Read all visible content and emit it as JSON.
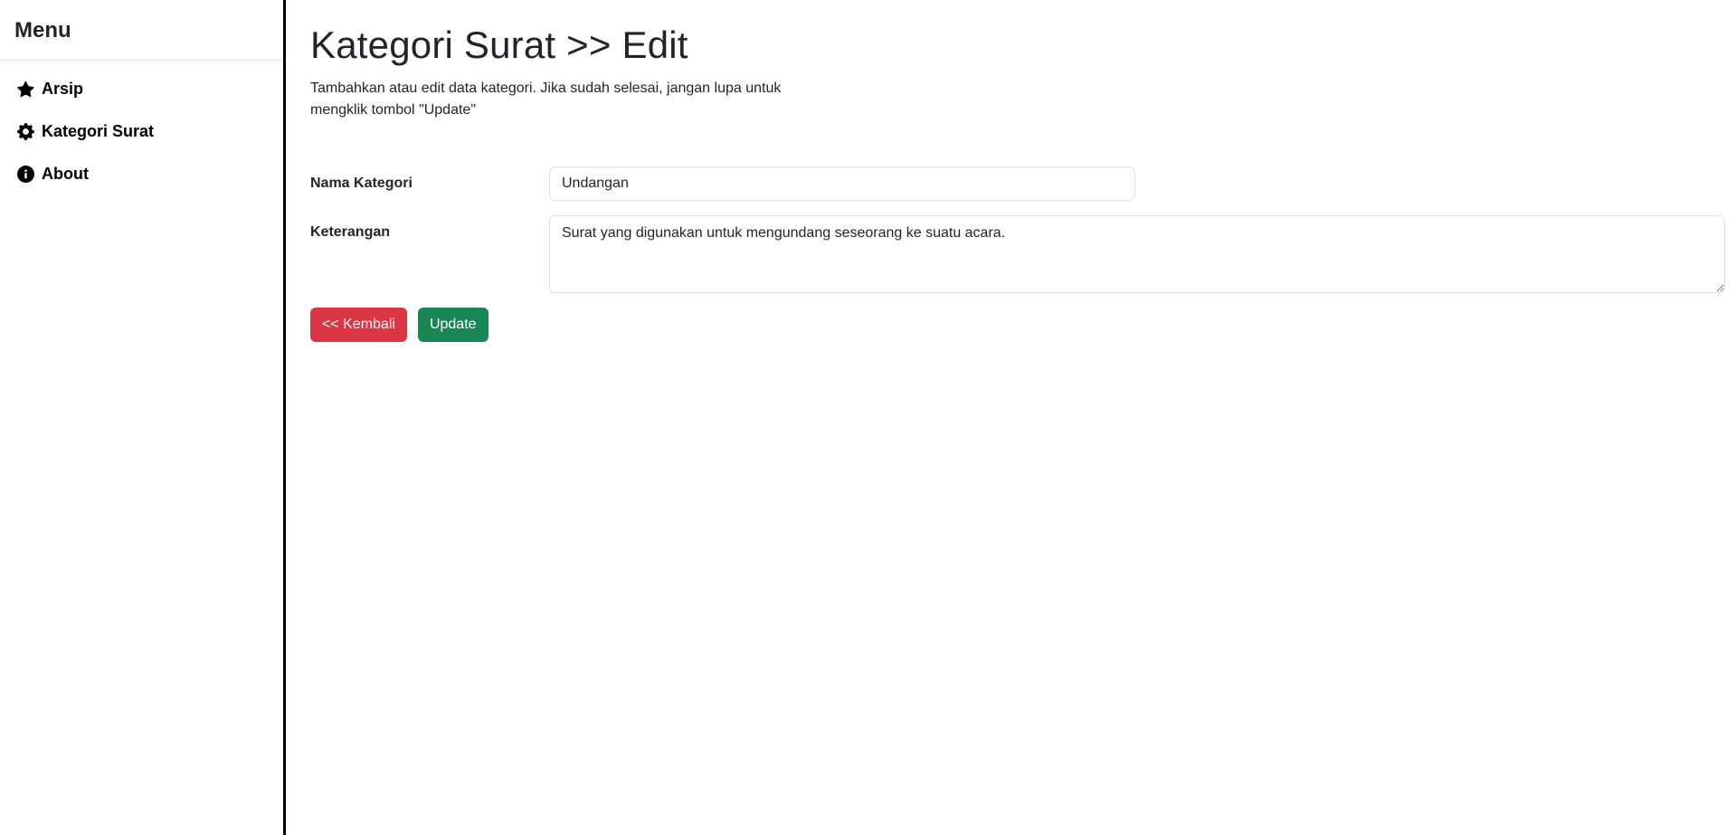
{
  "sidebar": {
    "title": "Menu",
    "items": [
      {
        "label": "Arsip",
        "icon": "star-icon"
      },
      {
        "label": "Kategori Surat",
        "icon": "gear-icon"
      },
      {
        "label": "About",
        "icon": "info-icon"
      }
    ]
  },
  "main": {
    "title": "Kategori Surat >> Edit",
    "description": "Tambahkan atau edit data kategori. Jika sudah selesai, jangan lupa untuk mengklik tombol \"Update\""
  },
  "form": {
    "nama_kategori": {
      "label": "Nama Kategori",
      "value": "Undangan"
    },
    "keterangan": {
      "label": "Keterangan",
      "value": "Surat yang digunakan untuk mengundang seseorang ke suatu acara."
    }
  },
  "buttons": {
    "back_label": "<< Kembali",
    "update_label": "Update"
  },
  "colors": {
    "danger": "#dc3545",
    "success": "#198754"
  }
}
